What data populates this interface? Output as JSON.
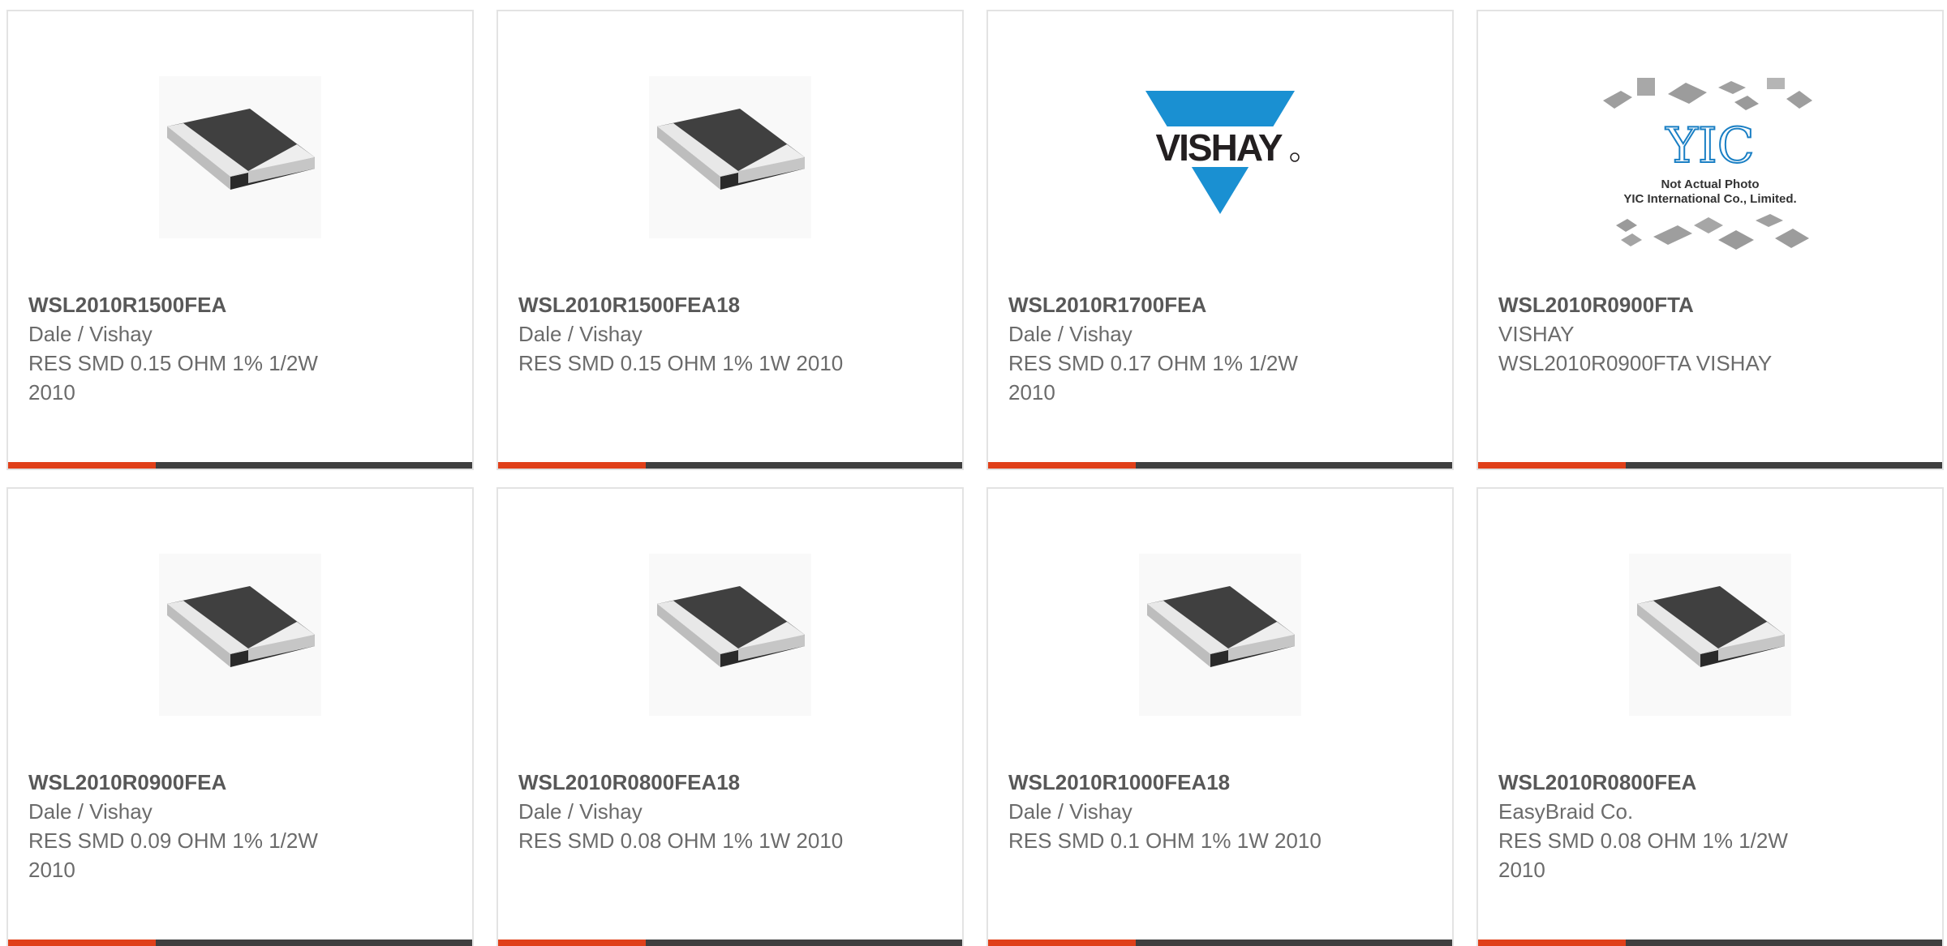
{
  "colors": {
    "accent": "#e0401a",
    "bar": "#3f3f3f",
    "title_text": "#585858",
    "body_text": "#6b6b6b",
    "border": "#e3e3e3",
    "vishay_blue": "#1a90d2"
  },
  "products": [
    {
      "part_number": "WSL2010R1500FEA",
      "manufacturer": "Dale / Vishay",
      "description": "RES SMD 0.15 OHM 1% 1/2W 2010",
      "image": "smd-resistor-icon"
    },
    {
      "part_number": "WSL2010R1500FEA18",
      "manufacturer": "Dale / Vishay",
      "description": "RES SMD 0.15 OHM 1% 1W 2010",
      "image": "smd-resistor-icon"
    },
    {
      "part_number": "WSL2010R1700FEA",
      "manufacturer": "Dale / Vishay",
      "description": "RES SMD 0.17 OHM 1% 1/2W 2010",
      "image": "vishay-logo",
      "logo_text": "VISHAY"
    },
    {
      "part_number": "WSL2010R0900FTA",
      "manufacturer": "VISHAY",
      "description": "WSL2010R0900FTA VISHAY",
      "image": "yic-placeholder-icon",
      "placeholder_logo": "YIC",
      "placeholder_line1": "Not Actual Photo",
      "placeholder_line2": "YIC International Co., Limited."
    },
    {
      "part_number": "WSL2010R0900FEA",
      "manufacturer": "Dale / Vishay",
      "description": "RES SMD 0.09 OHM 1% 1/2W 2010",
      "image": "smd-resistor-icon"
    },
    {
      "part_number": "WSL2010R0800FEA18",
      "manufacturer": "Dale / Vishay",
      "description": "RES SMD 0.08 OHM 1% 1W 2010",
      "image": "smd-resistor-icon"
    },
    {
      "part_number": "WSL2010R1000FEA18",
      "manufacturer": "Dale / Vishay",
      "description": "RES SMD 0.1 OHM 1% 1W 2010",
      "image": "smd-resistor-icon"
    },
    {
      "part_number": "WSL2010R0800FEA",
      "manufacturer": "EasyBraid Co.",
      "description": "RES SMD 0.08 OHM 1% 1/2W 2010",
      "image": "smd-resistor-icon"
    }
  ]
}
